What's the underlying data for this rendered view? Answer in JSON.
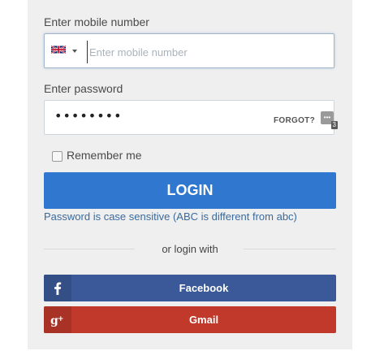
{
  "mobile": {
    "label": "Enter mobile number",
    "placeholder": "Enter mobile number",
    "country_flag": "uk-flag-icon"
  },
  "password": {
    "label": "Enter password",
    "masked_value": "••••••••",
    "forgot_label": "FORGOT?",
    "manager_count": "3"
  },
  "remember": {
    "label": "Remember me",
    "checked": false
  },
  "login": {
    "label": "LOGIN",
    "hint": "Password is case sensitive (ABC is different from abc)"
  },
  "social": {
    "divider_text": "or login with",
    "facebook_label": "Facebook",
    "gmail_label": "Gmail"
  },
  "colors": {
    "panel_bg": "#efefef",
    "login_blue": "#2f77cf",
    "facebook_blue": "#3b5998",
    "gmail_red": "#c0392b"
  }
}
